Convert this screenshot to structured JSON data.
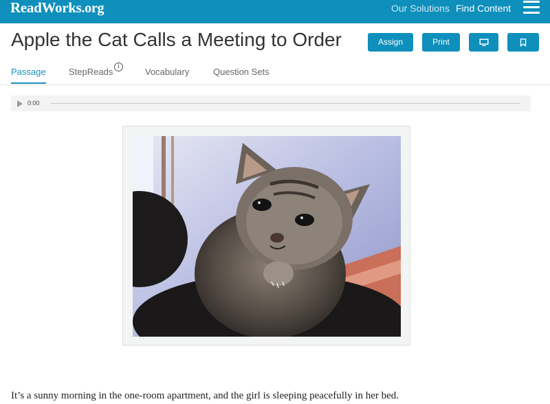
{
  "header": {
    "logo_text": "ReadWorks",
    "logo_suffix": ".org",
    "nav": [
      "Our Solutions",
      "Find Content"
    ],
    "menu_icon": "hamburger-menu-icon"
  },
  "article": {
    "title": "Apple the Cat Calls a Meeting to Order",
    "buttons": {
      "assign": "Assign",
      "print": "Print",
      "present_icon": "monitor-icon",
      "bookmark_icon": "bookmark-icon"
    },
    "tabs": [
      "Passage",
      "StepReads",
      "Vocabulary",
      "Question Sets"
    ],
    "active_tab": "Passage"
  },
  "audio": {
    "time": "0:00",
    "progress": 0
  },
  "image": {
    "subject": "kitten-photo"
  },
  "passage": {
    "first_sentence": "It’s a sunny morning in the one-room apartment, and the girl is sleeping peacefully in her bed."
  },
  "colors": {
    "brand": "#0e8fbc",
    "tab_active": "#1a8fbf",
    "frame_bg": "#f2f5f3"
  }
}
